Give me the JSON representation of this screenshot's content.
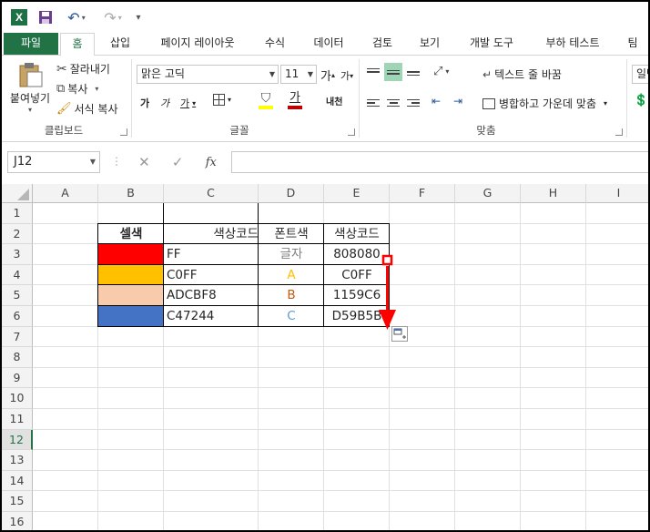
{
  "qat": {
    "logo": "X",
    "save_icon": "save-icon",
    "undo_icon": "undo-icon",
    "redo_icon": "redo-icon",
    "customize": "="
  },
  "tabs": {
    "file": "파일",
    "home": "홈",
    "insert": "삽입",
    "page_layout": "페이지 레이아웃",
    "formulas": "수식",
    "data": "데이터",
    "review": "검토",
    "view": "보기",
    "developer": "개발 도구",
    "load_test": "부하 테스트",
    "team": "팀"
  },
  "ribbon": {
    "clipboard": {
      "paste": "붙여넣기",
      "cut": "잘라내기",
      "copy": "복사",
      "format_painter": "서식 복사",
      "label": "클립보드"
    },
    "font": {
      "name": "맑은 고딕",
      "size": "11",
      "grow": "가",
      "shrink": "가",
      "bold": "가",
      "italic": "가",
      "underline": "가",
      "font_color_glyph": "가",
      "phonetic": "내천",
      "label": "글꼴"
    },
    "alignment": {
      "wrap_text": "텍스트 줄 바꿈",
      "merge_center": "병합하고 가운데 맞춤",
      "label": "맞춤"
    },
    "number": {
      "format": "일반"
    }
  },
  "formula_bar": {
    "name_box": "J12",
    "cancel": "✕",
    "enter": "✓",
    "fx": "fx",
    "value": ""
  },
  "columns": [
    "A",
    "B",
    "C",
    "D",
    "E",
    "F",
    "G",
    "H",
    "I"
  ],
  "rows": [
    "1",
    "2",
    "3",
    "4",
    "5",
    "6",
    "7",
    "8",
    "9",
    "10",
    "11",
    "12",
    "13",
    "14",
    "15",
    "16"
  ],
  "selected_row": "12",
  "table": {
    "headers": {
      "cell_color": "셀색",
      "color_code": "색상코드",
      "font_color": "폰트색",
      "color_code2": "색상코드"
    },
    "rows": [
      {
        "fill": "#FF0000",
        "code": "FF",
        "font_text": "글자",
        "font_hex": "#808080",
        "code2": "808080"
      },
      {
        "fill": "#FFC000",
        "code": "C0FF",
        "font_text": "A",
        "font_hex": "#FFC000",
        "code2": "C0FF"
      },
      {
        "fill": "#F8CBAD",
        "code": "ADCBF8",
        "font_text": "B",
        "font_hex": "#C65911",
        "code2": "1159C6"
      },
      {
        "fill": "#4472C4",
        "code": "C47244",
        "font_text": "C",
        "font_hex": "#5B9BD5",
        "code2": "D59B5B"
      }
    ]
  },
  "colors": {
    "excel_green": "#217346",
    "annotation_red": "#FF0000"
  }
}
